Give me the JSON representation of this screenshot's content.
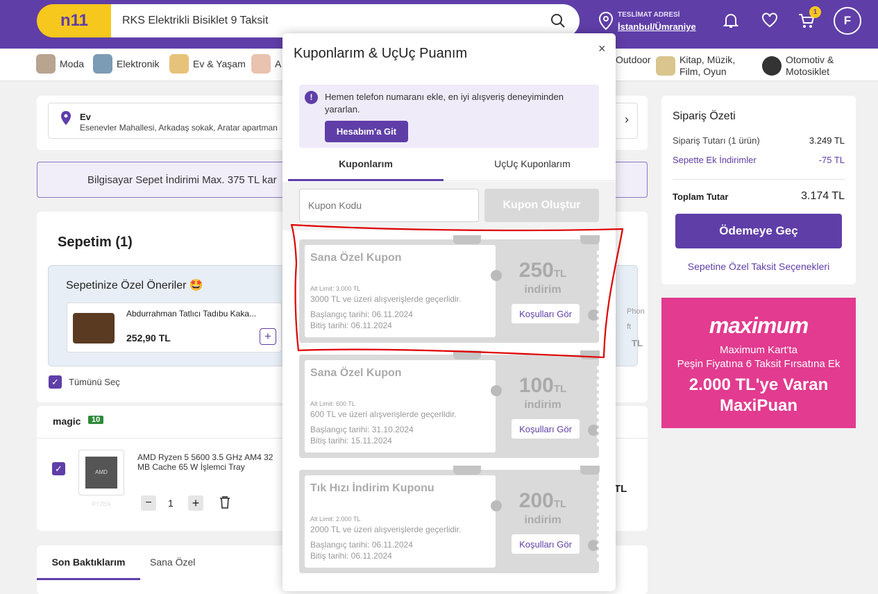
{
  "header": {
    "logo": "n11",
    "search_value": "RKS Elektrikli Bisiklet 9 Taksit",
    "address_label": "TESLİMAT ADRESİ",
    "address_value": "İstanbul/Ümraniye",
    "cart_count": "1",
    "avatar_initial": "F"
  },
  "categories": [
    {
      "label": "Moda"
    },
    {
      "label": "Elektronik"
    },
    {
      "label": "Ev & Yaşam"
    },
    {
      "label": "A"
    },
    {
      "label": "Outdoor"
    },
    {
      "label": "Kitap, Müzik, Film, Oyun"
    },
    {
      "label": "Otomotiv & Motosiklet"
    }
  ],
  "address_box": {
    "title": "Ev",
    "detail": "Esenevler Mahallesi, Arkadaş sokak, Aratar apartman"
  },
  "promo_banner": "Bilgisayar Sepet İndirimi Max. 375 TL kar",
  "cart": {
    "title": "Sepetim (1)",
    "suggest_title": "Sepetinize Özel Öneriler 🤩",
    "suggest_product": "Abdurrahman Tatlıcı Tadıbu Kaka...",
    "suggest_price": "252,90 TL",
    "suggest_right_text1": "Phon",
    "suggest_right_text2": "ft",
    "suggest_right_text3": "TL",
    "select_all": "Tümünü Seç",
    "seller_name": "magic",
    "seller_score": "10",
    "product_name": "AMD Ryzen 5 5600 3.5 GHz AM4 32 MB Cache 65 W İşlemci Tray",
    "product_thumb_text": "AMD RYZEN",
    "quantity": "1",
    "price_tail": "TL"
  },
  "bottom_tabs": [
    "Son Baktıklarım",
    "Sana Özel"
  ],
  "summary": {
    "title": "Sipariş Özeti",
    "order_label": "Sipariş Tutarı (1 ürün)",
    "order_value": "3.249 TL",
    "discount_label": "Sepette Ek İndirimler",
    "discount_value": "-75 TL",
    "total_label": "Toplam Tutar",
    "total_value": "3.174 TL",
    "pay_button": "Ödemeye Geç",
    "installment_link": "Sepetine Özel Taksit Seçenekleri"
  },
  "maximum_ad": {
    "brand": "maximum",
    "line1": "Maximum Kart'ta",
    "line2": "Peşin Fiyatına 6 Taksit Fırsatına Ek",
    "line3": "2.000 TL'ye Varan",
    "line4": "MaxiPuan"
  },
  "modal": {
    "title": "Kuponlarım & UçUç Puanım",
    "close": "×",
    "alert_text": "Hemen telefon numaranı ekle, en iyi alışveriş deneyiminden yararlan.",
    "alert_button": "Hesabım'a Git",
    "tabs": [
      "Kuponlarım",
      "UçUç Kuponlarım"
    ],
    "coupon_placeholder": "Kupon Kodu",
    "create_button": "Kupon Oluştur",
    "coupons": [
      {
        "title": "Sana Özel Kupon",
        "limit": "Alt Limit: 3.000 TL",
        "desc": "3000 TL ve üzeri alışverişlerde geçerlidir.",
        "start": "Başlangıç tarihi: 06.11.2024",
        "end": "Bitiş tarihi: 06.11.2024",
        "amount": "250",
        "currency": "TL",
        "discount_word": "indirim",
        "button": "Koşulları Gör"
      },
      {
        "title": "Sana Özel Kupon",
        "limit": "Alt Limit: 600 TL",
        "desc": "600 TL ve üzeri alışverişlerde geçerlidir.",
        "start": "Başlangıç tarihi: 31.10.2024",
        "end": "Bitiş tarihi: 15.11.2024",
        "amount": "100",
        "currency": "TL",
        "discount_word": "indirim",
        "button": "Koşulları Gör"
      },
      {
        "title": "Tık Hızı İndirim Kuponu",
        "limit": "Alt Limit: 2.000 TL",
        "desc": "2000 TL ve üzeri alışverişlerde geçerlidir.",
        "start": "Başlangıç tarihi: 06.11.2024",
        "end": "Bitiş tarihi: 06.11.2024",
        "amount": "200",
        "currency": "TL",
        "discount_word": "indirim",
        "button": "Koşulları Gör"
      }
    ]
  },
  "colors": {
    "brand": "#5f3ea8",
    "accent": "#f6c71c",
    "annotation": "#e00000"
  }
}
